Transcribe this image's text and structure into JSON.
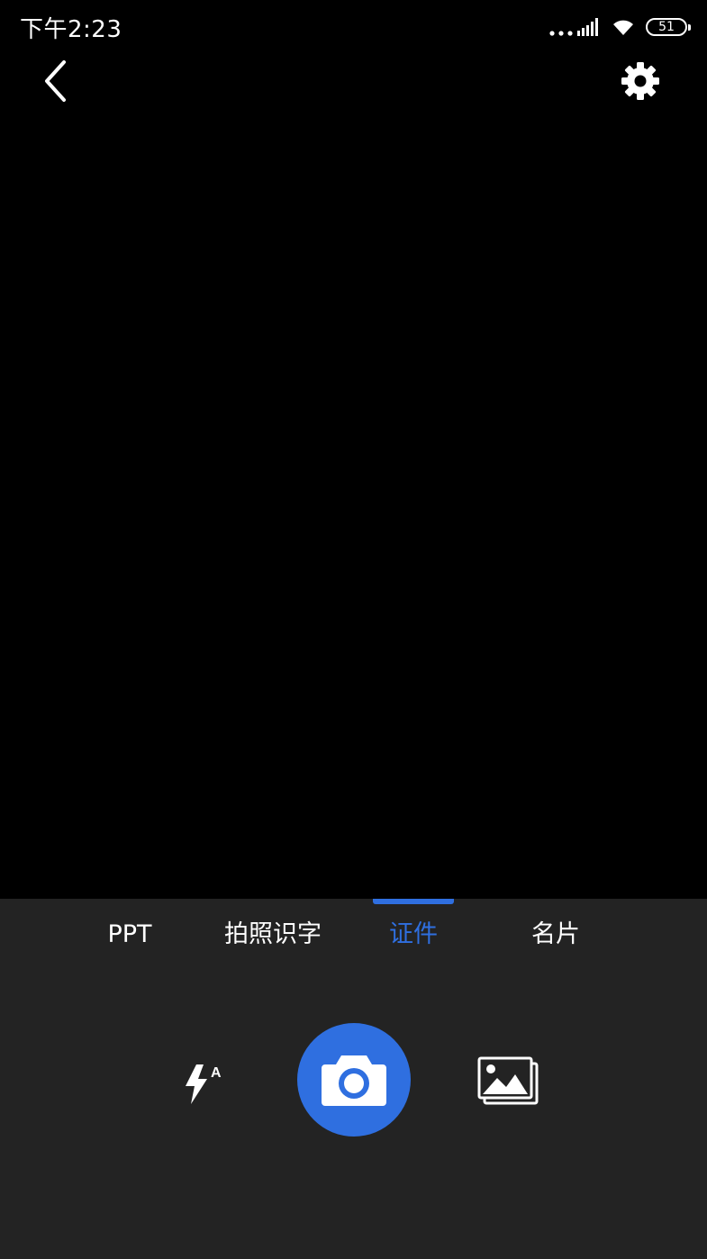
{
  "status_bar": {
    "time": "下午2:23",
    "battery": "51"
  },
  "header": {
    "back_icon": "chevron-left-icon",
    "settings_icon": "gear-icon"
  },
  "mode_tabs": [
    {
      "label": "PPT",
      "active": false
    },
    {
      "label": "拍照识字",
      "active": false
    },
    {
      "label": "证件",
      "active": true
    },
    {
      "label": "名片",
      "active": false
    }
  ],
  "controls": {
    "flash_icon": "flash-auto-icon",
    "shutter_icon": "camera-icon",
    "gallery_icon": "gallery-icon"
  },
  "colors": {
    "accent": "#2f6fe0",
    "panel_background": "#232323",
    "viewfinder_background": "#000000"
  }
}
